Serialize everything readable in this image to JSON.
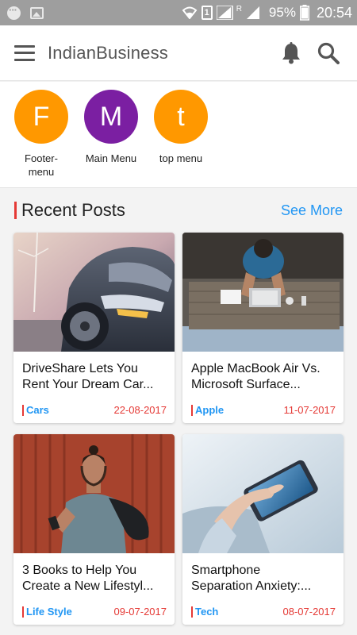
{
  "status_bar": {
    "battery": "95%",
    "time": "20:54",
    "sim": "1",
    "network_badge": "R",
    "icons": [
      "chat-notification-icon",
      "gallery-notification-icon",
      "wifi-icon",
      "sim-icon",
      "signal-icon",
      "battery-icon"
    ]
  },
  "app_bar": {
    "title": "IndianBusiness",
    "icons": [
      "menu-icon",
      "bell-icon",
      "search-icon"
    ]
  },
  "shortcuts": [
    {
      "letter": "F",
      "label_line1": "Footer-",
      "label_line2": "menu",
      "color": "#ff9800"
    },
    {
      "letter": "M",
      "label_line1": "Main Menu",
      "label_line2": "",
      "color": "#7b1fa2"
    },
    {
      "letter": "t",
      "label_line1": "top menu",
      "label_line2": "",
      "color": "#ff9800"
    }
  ],
  "recent": {
    "title": "Recent Posts",
    "see_more": "See More",
    "posts": [
      {
        "title_line1": "DriveShare Lets You",
        "title_line2": "Rent Your Dream Car...",
        "category": "Cars",
        "date": "22-08-2017"
      },
      {
        "title_line1": "Apple MacBook Air Vs.",
        "title_line2": "Microsoft Surface...",
        "category": "Apple",
        "date": "11-07-2017"
      },
      {
        "title_line1": "3 Books to Help You",
        "title_line2": "Create a New Lifestyl...",
        "category": "Life Style",
        "date": "09-07-2017"
      },
      {
        "title_line1": "Smartphone",
        "title_line2": "Separation Anxiety:...",
        "category": "Tech",
        "date": "08-07-2017"
      }
    ]
  },
  "colors": {
    "accent_blue": "#2196f3",
    "accent_red": "#e53935",
    "orange": "#ff9800",
    "purple": "#7b1fa2"
  }
}
